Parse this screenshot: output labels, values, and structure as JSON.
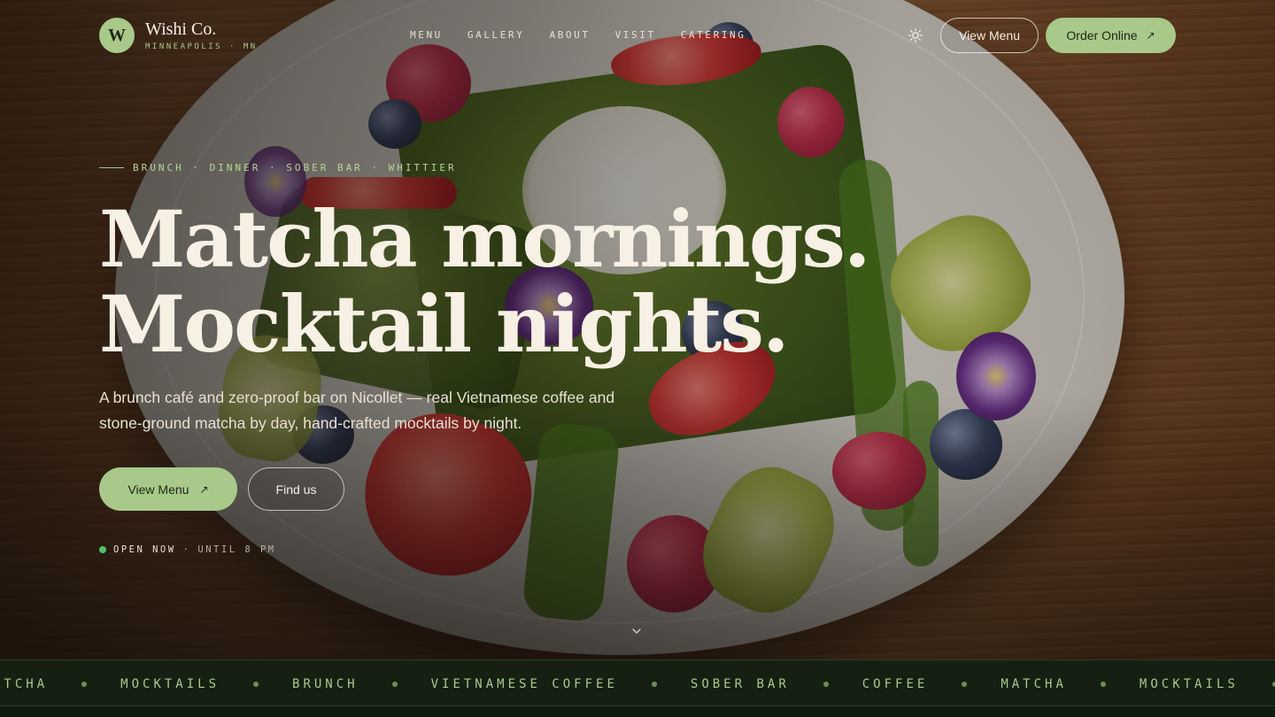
{
  "nav": {
    "logo_letter": "W",
    "brand_name": "Wishi Co.",
    "brand_location": "MINNEAPOLIS · MN",
    "links": [
      "MENU",
      "GALLERY",
      "ABOUT",
      "VISIT",
      "CATERING"
    ],
    "theme_icon": "sun-icon",
    "view_menu_label": "View Menu",
    "order_online_label": "Order Online",
    "order_online_icon": "arrow-up-right-icon"
  },
  "hero": {
    "eyebrow": "BRUNCH · DINNER · SOBER BAR · WHITTIER",
    "headline_line1": "Matcha mornings.",
    "headline_line2": "Mocktail nights.",
    "lede": "A brunch café and zero-proof bar on Nicollet — real Vietnamese coffee and stone-ground matcha by day, hand-crafted mocktails by night.",
    "primary_cta": "View Menu",
    "primary_cta_icon": "arrow-up-right-icon",
    "secondary_cta": "Find us",
    "status_open": "OPEN NOW",
    "status_sep": "·",
    "status_until": "UNTIL 8 PM",
    "scroll_icon": "chevron-down-icon"
  },
  "ticker": {
    "items": [
      "ATCHA",
      "MOCKTAILS",
      "BRUNCH",
      "VIETNAMESE COFFEE",
      "SOBER BAR",
      "COFFEE",
      "MATCHA",
      "MOCKTAILS"
    ]
  },
  "colors": {
    "accent_green": "#a8c98a",
    "ticker_bg": "#152012",
    "status_dot": "#4cc36a",
    "text_cream": "#f7f0e4"
  }
}
